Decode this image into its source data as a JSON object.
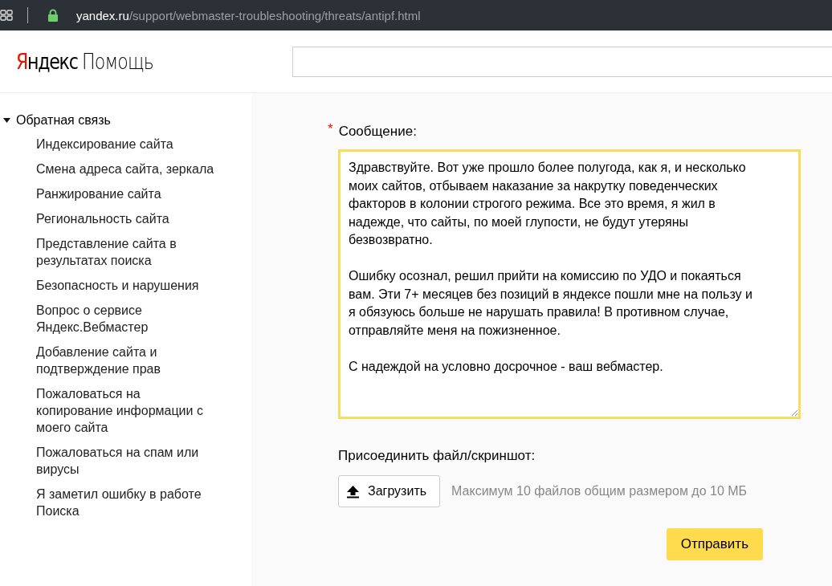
{
  "browser": {
    "url_host": "yandex.ru",
    "url_path": "/support/webmaster-troubleshooting/threats/antipf.html",
    "secure": true
  },
  "header": {
    "logo_brand": "Яндекс",
    "logo_product": "Помощь"
  },
  "sidebar": {
    "section": {
      "label": "Обратная связь",
      "expanded": true
    },
    "items": [
      {
        "label": "Индексирование сайта"
      },
      {
        "label": "Смена адреса сайта, зеркала"
      },
      {
        "label": "Ранжирование сайта"
      },
      {
        "label": "Региональность сайта"
      },
      {
        "label": "Представление сайта в результатах поиска"
      },
      {
        "label": "Безопасность и нарушения"
      },
      {
        "label": "Вопрос о сервисе Яндекс.Вебмастер"
      },
      {
        "label": "Добавление сайта и подтверждение прав"
      },
      {
        "label": "Пожаловаться на копирование информации с моего сайта"
      },
      {
        "label": "Пожаловаться на спам или вирусы"
      },
      {
        "label": "Я заметил ошибку в работе Поиска"
      }
    ]
  },
  "form": {
    "message_label": "Сообщение:",
    "required": true,
    "required_mark": "*",
    "message_paragraphs": [
      "Здравствуйте. Вот уже прошло более полугода, как я, и несколько моих сайтов, отбываем наказание за накрутку поведенческих факторов в колонии строгого режима. Все это время, я жил в надежде, что сайты, по моей глупости, не будут утеряны безвозвратно.",
      "Ошибку осознал, решил прийти на комиссию по УДО и покаяться вам. Эти 7+ месяцев без позиций в яндексе пошли мне на пользу и я обязуюсь больше не нарушать правила! В противном случае, отправляйте меня на пожизненное.",
      "С надеждой на условно досрочное - ваш вебмастер."
    ],
    "attach_label": "Присоединить файл/скриншот:",
    "upload_button": "Загрузить",
    "attach_hint": "Максимум 10 файлов общим размером до 10 МБ",
    "submit_button": "Отправить"
  }
}
